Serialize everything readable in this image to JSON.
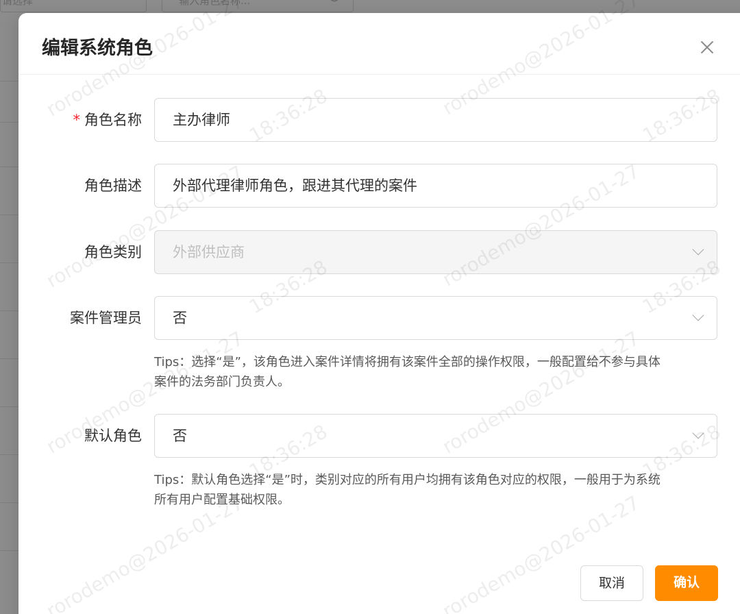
{
  "background": {
    "select_placeholder": "请选择",
    "search_placeholder": "输入角色名称..."
  },
  "modal": {
    "title": "编辑系统角色",
    "fields": {
      "role_name": {
        "label": "角色名称",
        "required_mark": "*",
        "value": "主办律师"
      },
      "role_desc": {
        "label": "角色描述",
        "value": "外部代理律师角色，跟进其代理的案件"
      },
      "role_type": {
        "label": "角色类别",
        "value": "外部供应商"
      },
      "case_admin": {
        "label": "案件管理员",
        "value": "否",
        "tips_line1": "Tips：选择“是”，该角色进入案件详情将拥有该案件全部的操作权限，一般配置给不参与具体",
        "tips_line2": "案件的法务部门负责人。"
      },
      "default_role": {
        "label": "默认角色",
        "value": "否",
        "tips_line1": "Tips：默认角色选择“是”时，类别对应的所有用户均拥有该角色对应的权限，一般用于为系统",
        "tips_line2": "所有用户配置基础权限。"
      }
    },
    "buttons": {
      "cancel": "取消",
      "confirm": "确认"
    }
  },
  "watermark": {
    "user": "rorodemo@2026-01-27",
    "time": "18:36:28"
  },
  "colors": {
    "accent": "#ff8c00",
    "required": "#f5222d"
  }
}
